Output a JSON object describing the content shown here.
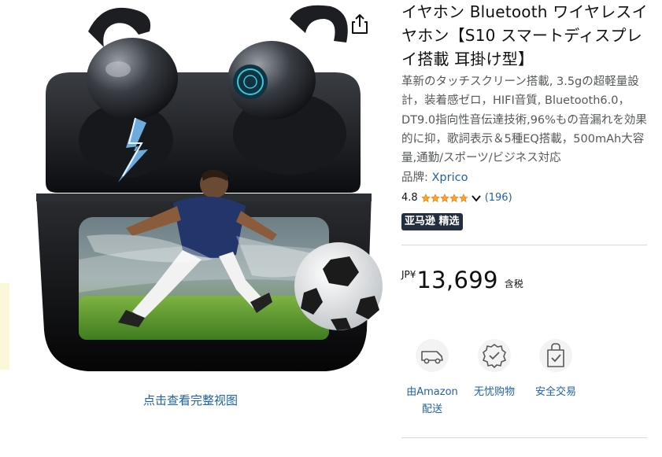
{
  "gallery": {
    "view_full_label": "点击查看完整视图",
    "share_icon": "share-icon"
  },
  "product": {
    "title": "イヤホン Bluetooth ワイヤレスイヤホン【S10 スマートディスプレイ搭載 耳掛け型】",
    "description": "革新のタッチスクリーン搭載, 3.5gの超軽量設計，装着感ゼロ，HIFI音質, Bluetooth6.0，DT9.0指向性音伝達技術,96%もの音漏れを効果的に抑，歌詞表示＆5種EQ搭載，500mAh大容量,通勤/スポーツ/ビジネス対応",
    "brand_label": "品牌: ",
    "brand_name": "Xprico",
    "rating": "4.8",
    "rating_stars": 4.8,
    "review_count": "(196)",
    "badge": "亚马逊 精选",
    "price_currency": "JP¥",
    "price": "13,699",
    "price_tax": "含税",
    "star_color": "#ffa41c",
    "link_color": "#2162a1"
  },
  "features": [
    {
      "icon": "delivery-van-icon",
      "label": "由Amazon 配送"
    },
    {
      "icon": "shield-check-icon",
      "label": "无忧购物"
    },
    {
      "icon": "lock-bag-icon",
      "label": "安全交易"
    }
  ]
}
